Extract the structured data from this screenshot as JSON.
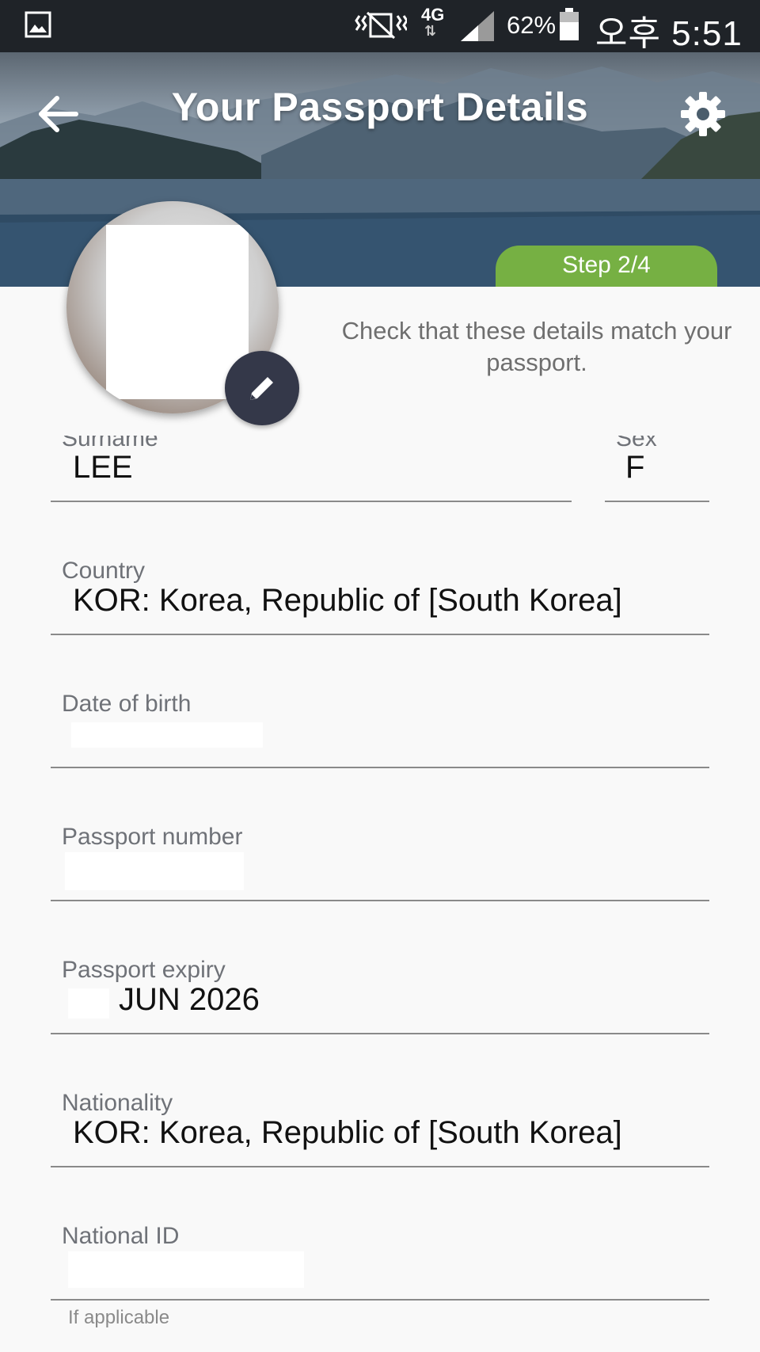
{
  "status_bar": {
    "battery_percent": "62%",
    "network": "4G",
    "time": "오후 5:51"
  },
  "header": {
    "title": "Your Passport Details",
    "step": "Step 2/4"
  },
  "instruction": "Check that these details match your passport.",
  "fields": {
    "surname": {
      "label": "Surname",
      "value": "LEE"
    },
    "sex": {
      "label": "Sex",
      "value": "F"
    },
    "country": {
      "label": "Country",
      "value": "KOR: Korea, Republic of [South Korea]"
    },
    "date_of_birth": {
      "label": "Date of birth",
      "value": ""
    },
    "passport_number": {
      "label": "Passport number",
      "value": ""
    },
    "passport_expiry": {
      "label": "Passport expiry",
      "value": "JUN 2026"
    },
    "nationality": {
      "label": "Nationality",
      "value": "KOR: Korea, Republic of [South Korea]"
    },
    "national_id": {
      "label": "National ID",
      "value": "",
      "hint": "If applicable"
    }
  },
  "colors": {
    "step_badge": "#76b043",
    "edit_button": "#343849",
    "status_bar": "#1f2328"
  },
  "icons": [
    "gallery-icon",
    "vibrate-icon",
    "signal-icon",
    "battery-icon",
    "back-arrow-icon",
    "gear-icon",
    "pencil-icon"
  ]
}
